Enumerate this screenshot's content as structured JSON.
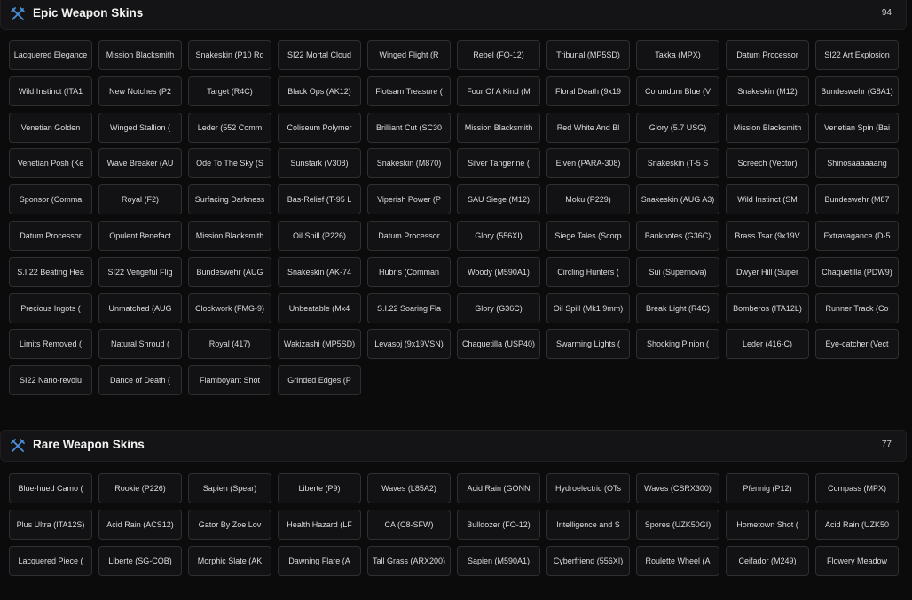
{
  "icons": {
    "accent": "#4a90d9",
    "section_icon": "crossed-swords-icon"
  },
  "epic": {
    "title": "Epic Weapon Skins",
    "count": "94",
    "items": [
      "Lacquered Elegance",
      "Mission Blacksmith",
      "Snakeskin (P10 Ro",
      "SI22 Mortal Cloud",
      "Winged Flight (R",
      "Rebel (FO-12)",
      "Tribunal (MP5SD)",
      "Takka (MPX)",
      "Datum Processor",
      "SI22 Art Explosion",
      "Wild Instinct (ITA1",
      "New Notches (P2",
      "Target (R4C)",
      "Black Ops (AK12)",
      "Flotsam Treasure (",
      "Four Of A Kind (M",
      "Floral Death (9x19",
      "Corundum Blue (V",
      "Snakeskin (M12)",
      "Bundeswehr (G8A1)",
      "Venetian Golden",
      "Winged Stallion (",
      "Leder (552 Comm",
      "Coliseum Polymer",
      "Brilliant Cut (SC30",
      "Mission Blacksmith",
      "Red White And Bl",
      "Glory (5.7 USG)",
      "Mission Blacksmith",
      "Venetian Spin (Bai",
      "Venetian Posh (Ke",
      "Wave Breaker (AU",
      "Ode To The Sky (S",
      "Sunstark (V308)",
      "Snakeskin (M870)",
      "Silver Tangerine (",
      "Elven (PARA-308)",
      "Snakeskin (T-5 S",
      "Screech (Vector)",
      "Shinosaaaaaang",
      "Sponsor (Comma",
      "Royal (F2)",
      "Surfacing Darkness",
      "Bas-Relief (T-95 L",
      "Viperish Power (P",
      "SAU Siege (M12)",
      "Moku (P229)",
      "Snakeskin (AUG A3)",
      "Wild Instinct (SM",
      "Bundeswehr (M87",
      "Datum Processor",
      "Opulent Benefact",
      "Mission Blacksmith",
      "Oil Spill (P226)",
      "Datum Processor",
      "Glory (556XI)",
      "Siege Tales (Scorp",
      "Banknotes (G36C)",
      "Brass Tsar (9x19V",
      "Extravagance (D-5",
      "S.I.22 Beating Hea",
      "SI22 Vengeful Flig",
      "Bundeswehr (AUG",
      "Snakeskin (AK-74",
      "Hubris (Comman",
      "Woody (M590A1)",
      "Circling Hunters (",
      "Sui (Supernova)",
      "Dwyer Hill (Super",
      "Chaquetilla (PDW9)",
      "Precious Ingots (",
      "Unmatched (AUG",
      "Clockwork (FMG-9)",
      "Unbeatable (Mx4",
      "S.I.22 Soaring Fla",
      "Glory (G36C)",
      "Oil Spill (Mk1 9mm)",
      "Break Light (R4C)",
      "Bomberos (ITA12L)",
      "Runner Track (Co",
      "Limits Removed (",
      "Natural Shroud (",
      "Royal (417)",
      "Wakizashi (MP5SD)",
      "Levasoj (9x19VSN)",
      "Chaquetilla (USP40)",
      "Swarming Lights (",
      "Shocking Pinion (",
      "Leder (416-C)",
      "Eye-catcher (Vect",
      "SI22 Nano-revolu",
      "Dance of Death (",
      "Flamboyant Shot",
      "Grinded Edges (P"
    ]
  },
  "rare": {
    "title": "Rare Weapon Skins",
    "count": "77",
    "items": [
      "Blue-hued Camo (",
      "Rookie (P226)",
      "Sapien (Spear)",
      "Liberte (P9)",
      "Waves (L85A2)",
      "Acid Rain (GONN",
      "Hydroelectric (OTs",
      "Waves (CSRX300)",
      "Pfennig (P12)",
      "Compass (MPX)",
      "Plus Ultra (ITA12S)",
      "Acid Rain (ACS12)",
      "Gator By Zoe Lov",
      "Health Hazard (LF",
      "CA (C8-SFW)",
      "Bulldozer (FO-12)",
      "Intelligence and S",
      "Spores (UZK50GI)",
      "Hometown Shot (",
      "Acid Rain (UZK50",
      "Lacquered Piece (",
      "Liberte (SG-CQB)",
      "Morphic Slate (AK",
      "Dawning Flare (A",
      "Tall Grass (ARX200)",
      "Sapien (M590A1)",
      "Cyberfriend (556XI)",
      "Roulette Wheel (A",
      "Ceifador (M249)",
      "Flowery Meadow"
    ]
  }
}
